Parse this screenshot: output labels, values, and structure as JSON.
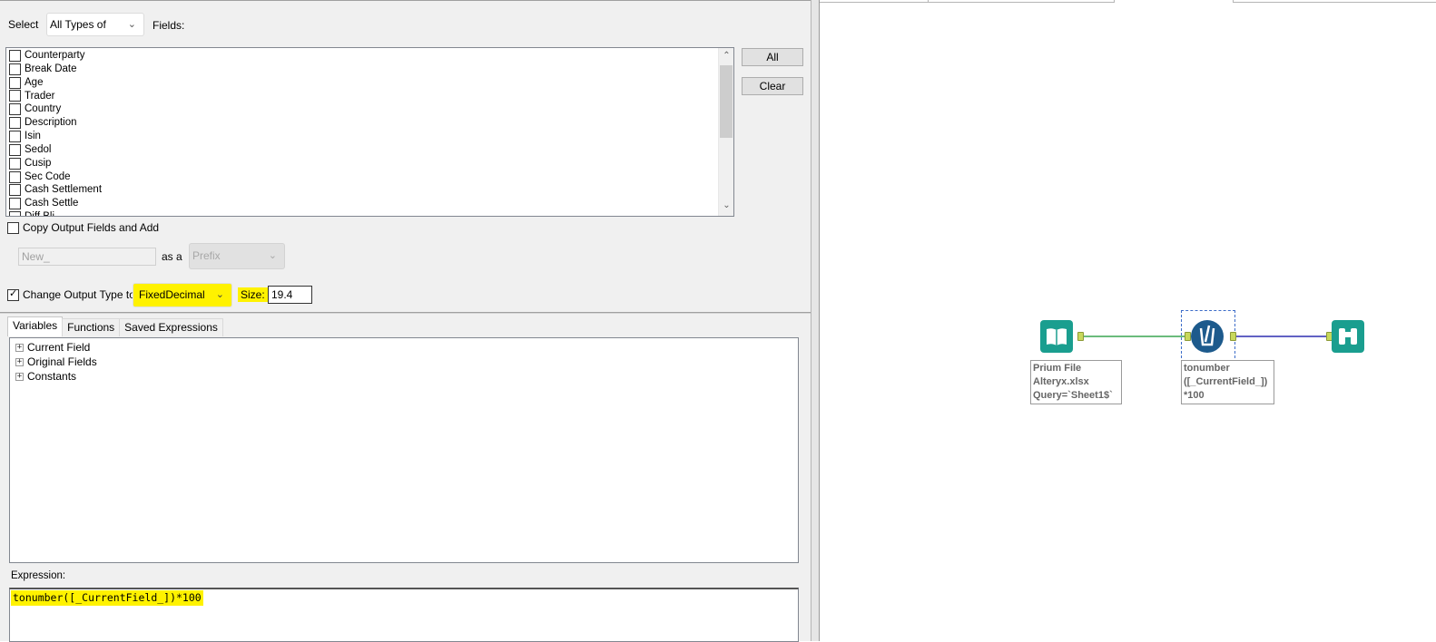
{
  "select_row": {
    "label": "Select",
    "dropdown_value": "All Types of",
    "fields_label": "Fields:"
  },
  "fields": [
    {
      "name": "Counterparty",
      "checked": false
    },
    {
      "name": "Break Date",
      "checked": false
    },
    {
      "name": "Age",
      "checked": false
    },
    {
      "name": "Trader",
      "checked": false
    },
    {
      "name": "Country",
      "checked": false
    },
    {
      "name": "Description",
      "checked": false
    },
    {
      "name": "Isin",
      "checked": false
    },
    {
      "name": "Sedol",
      "checked": false
    },
    {
      "name": "Cusip",
      "checked": false
    },
    {
      "name": "Sec Code",
      "checked": false
    },
    {
      "name": "Cash Settlement",
      "checked": false
    },
    {
      "name": "Cash Settle",
      "checked": false
    },
    {
      "name": "Diff Bli",
      "checked": false
    }
  ],
  "buttons": {
    "all_label": "All",
    "clear_label": "Clear"
  },
  "copy_output": {
    "label": "Copy Output Fields and Add",
    "checked": false,
    "name_value": "New_",
    "as_a_label": "as a",
    "position_value": "Prefix"
  },
  "change_type": {
    "label": "Change Output Type to",
    "checked": true,
    "type_value": "FixedDecimal",
    "size_label": "Size:",
    "size_value": "19.4"
  },
  "tabs": [
    {
      "label": "Variables",
      "active": true
    },
    {
      "label": "Functions",
      "active": false
    },
    {
      "label": "Saved Expressions",
      "active": false
    }
  ],
  "tree": [
    {
      "label": "Current Field"
    },
    {
      "label": "Original Fields"
    },
    {
      "label": "Constants"
    }
  ],
  "expression": {
    "label": "Expression:",
    "value": "tonumber([_CurrentField_])*100"
  },
  "workflow": {
    "input_tool": {
      "label_lines": [
        "Prium File",
        "Alteryx.xlsx",
        "Query=`Sheet1$`"
      ],
      "icon": "book-icon",
      "color": "#1a9e8f"
    },
    "formula_tool": {
      "label_lines": [
        "tonumber",
        "([_CurrentField_])",
        "*100"
      ],
      "icon": "formula-icon",
      "color": "#1d5a8c"
    },
    "browse_tool": {
      "icon": "binoculars-icon",
      "color": "#1a9e8f"
    },
    "connection_colors": {
      "first": "#3aa650",
      "second": "#2f2fb0"
    }
  },
  "colors": {
    "highlight": "#fff200"
  }
}
